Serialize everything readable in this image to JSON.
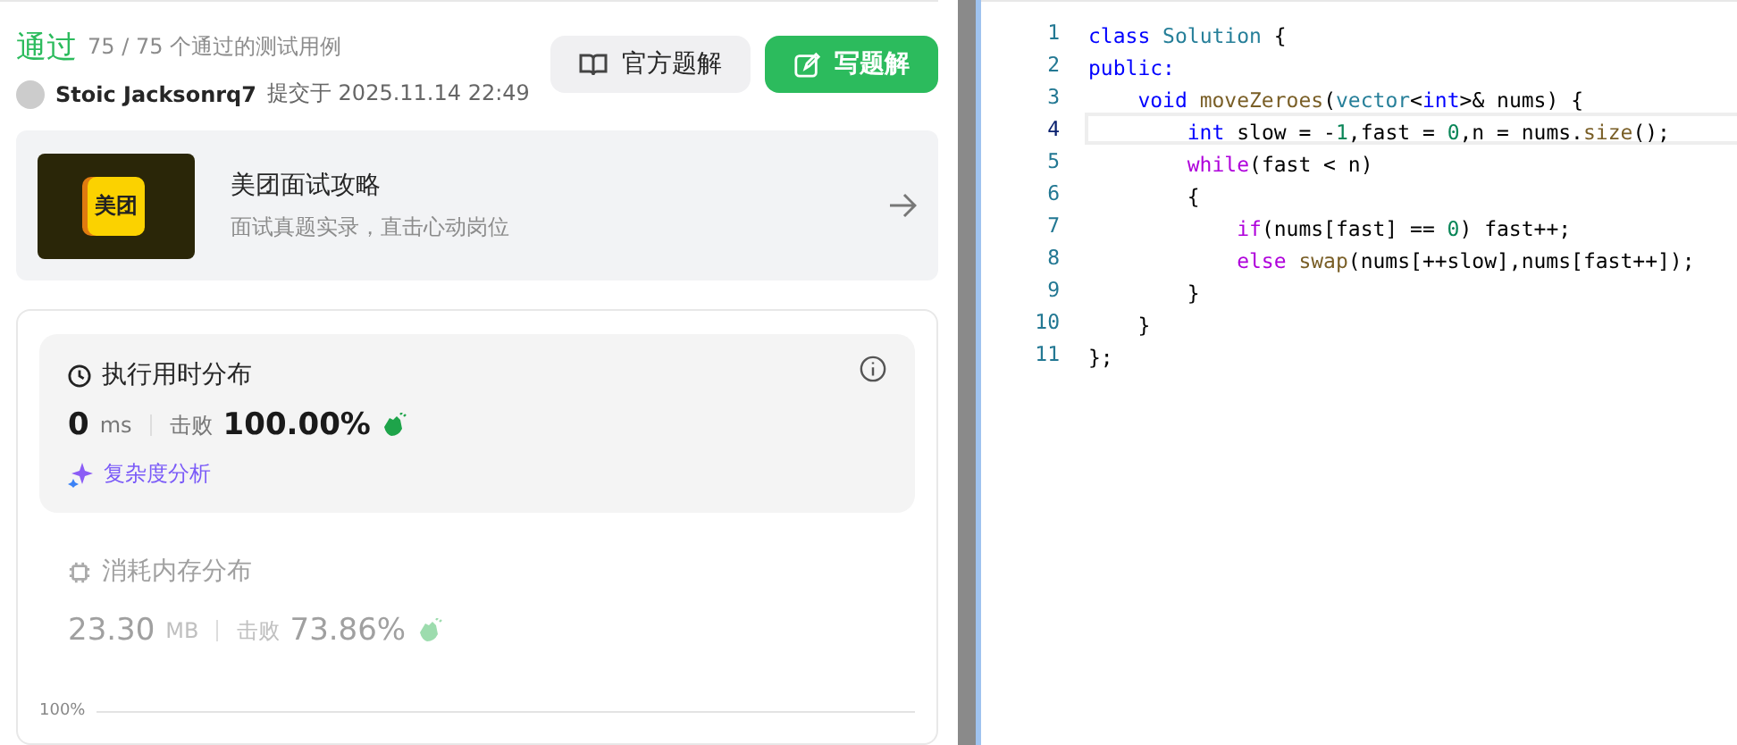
{
  "result": {
    "status": "通过",
    "tests": "75 / 75 个通过的测试用例",
    "user": "Stoic Jacksonrq7",
    "submitted": "提交于 2025.11.14 22:49"
  },
  "buttons": [
    {
      "label": "官方题解",
      "kind": "secondary"
    },
    {
      "label": "写题解",
      "kind": "primary"
    }
  ],
  "banner": {
    "logo": "美团",
    "title": "美团面试攻略",
    "subtitle": "面试真题实录，直击心动岗位"
  },
  "runtime": {
    "title": "执行用时分布",
    "value": "0",
    "unit": "ms",
    "beats_label": "击败",
    "beats": "100.00%",
    "analysis": "复杂度分析"
  },
  "memory": {
    "title": "消耗内存分布",
    "value": "23.30",
    "unit": "MB",
    "beats_label": "击败",
    "beats": "73.86%"
  },
  "chart_axis": "100%",
  "editor": {
    "lines": [
      {
        "number": "1",
        "selected": false,
        "tokens": [
          {
            "text": "class",
            "kind": "keyword"
          },
          {
            "text": " Solution",
            "kind": "type"
          },
          {
            "text": " {",
            "kind": "plain"
          }
        ]
      },
      {
        "number": "2",
        "selected": false,
        "tokens": [
          {
            "text": "public:",
            "kind": "keyword"
          }
        ]
      },
      {
        "number": "3",
        "selected": false,
        "tokens": [
          {
            "text": "    void",
            "kind": "keyword"
          },
          {
            "text": " moveZeroes",
            "kind": "function"
          },
          {
            "text": "(",
            "kind": "plain"
          },
          {
            "text": "vector",
            "kind": "type"
          },
          {
            "text": "<",
            "kind": "plain"
          },
          {
            "text": "int",
            "kind": "keyword"
          },
          {
            "text": ">& nums) {",
            "kind": "plain"
          }
        ]
      },
      {
        "number": "4",
        "selected": true,
        "tokens": [
          {
            "text": "        int",
            "kind": "keyword"
          },
          {
            "text": " slow = -",
            "kind": "plain"
          },
          {
            "text": "1",
            "kind": "number"
          },
          {
            "text": ",fast = ",
            "kind": "plain"
          },
          {
            "text": "0",
            "kind": "number"
          },
          {
            "text": ",n = nums.",
            "kind": "plain"
          },
          {
            "text": "size",
            "kind": "function"
          },
          {
            "text": "();",
            "kind": "plain"
          }
        ]
      },
      {
        "number": "5",
        "selected": false,
        "tokens": [
          {
            "text": "        while",
            "kind": "control"
          },
          {
            "text": "(fast < n)",
            "kind": "plain"
          }
        ]
      },
      {
        "number": "6",
        "selected": false,
        "tokens": [
          {
            "text": "        {",
            "kind": "plain"
          }
        ]
      },
      {
        "number": "7",
        "selected": false,
        "tokens": [
          {
            "text": "            if",
            "kind": "control"
          },
          {
            "text": "(nums[fast] == ",
            "kind": "plain"
          },
          {
            "text": "0",
            "kind": "number"
          },
          {
            "text": ") fast++;",
            "kind": "plain"
          }
        ]
      },
      {
        "number": "8",
        "selected": false,
        "tokens": [
          {
            "text": "            else",
            "kind": "control"
          },
          {
            "text": " swap",
            "kind": "function"
          },
          {
            "text": "(nums[++slow],nums[fast++]);",
            "kind": "plain"
          }
        ]
      },
      {
        "number": "9",
        "selected": false,
        "tokens": [
          {
            "text": "        }",
            "kind": "plain"
          }
        ]
      },
      {
        "number": "10",
        "selected": false,
        "tokens": [
          {
            "text": "    }",
            "kind": "plain"
          }
        ]
      },
      {
        "number": "11",
        "selected": false,
        "tokens": [
          {
            "text": "};",
            "kind": "plain"
          }
        ]
      }
    ]
  }
}
